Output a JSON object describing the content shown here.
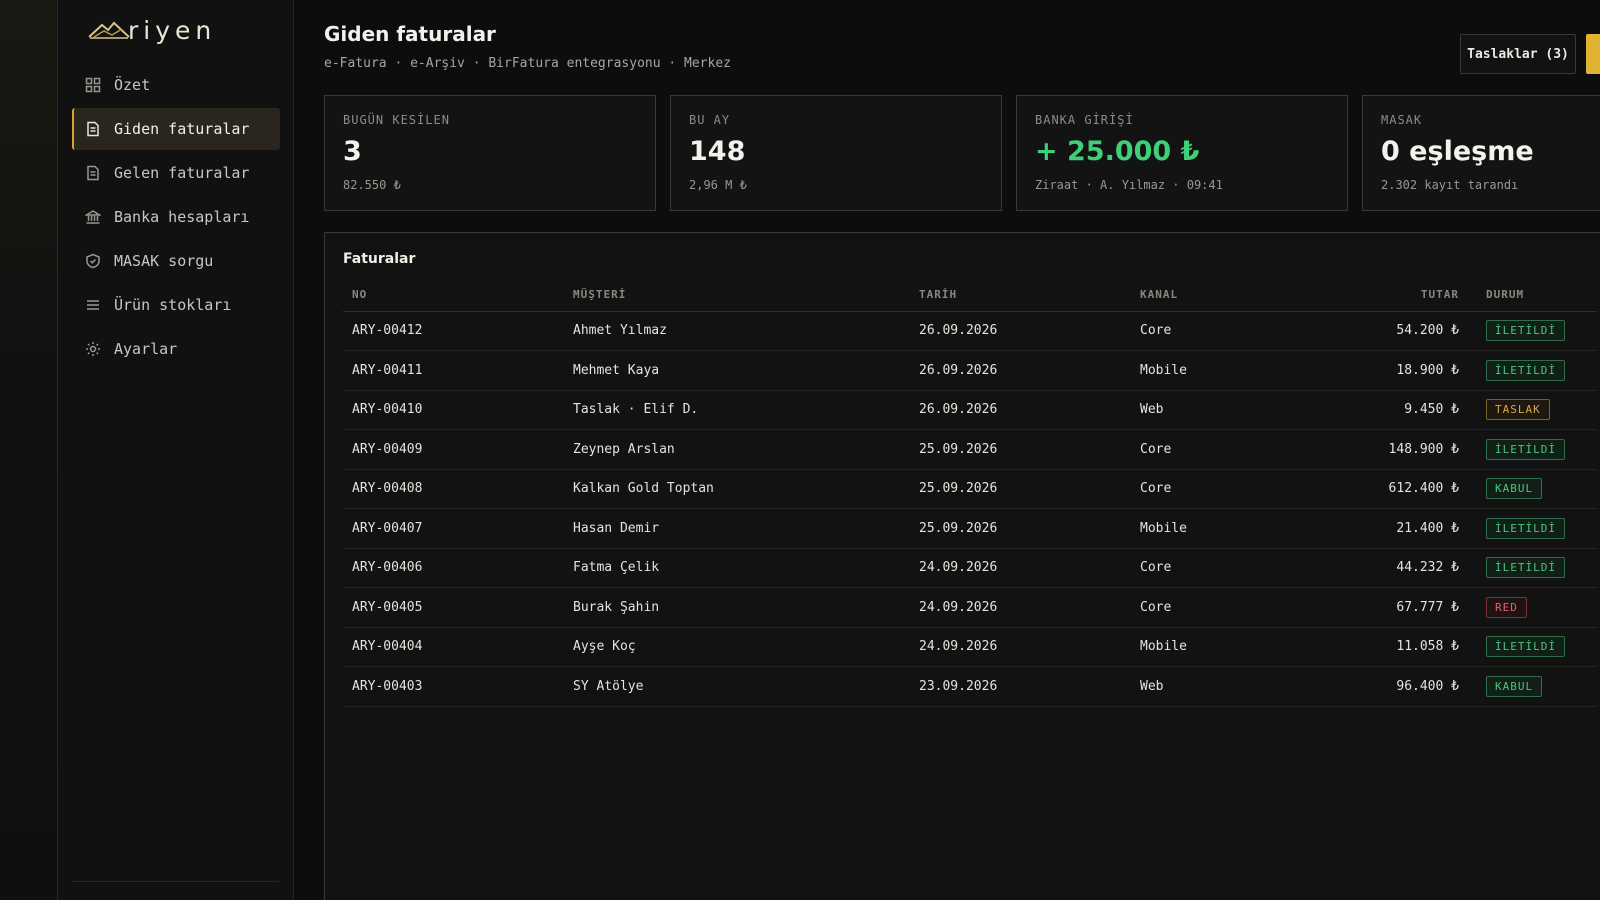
{
  "brand": {
    "name": "riyen"
  },
  "sidebar": {
    "items": [
      {
        "label": "Özet",
        "icon": "grid-icon",
        "active": false
      },
      {
        "label": "Giden faturalar",
        "icon": "document-icon",
        "active": true
      },
      {
        "label": "Gelen faturalar",
        "icon": "document-icon",
        "active": false
      },
      {
        "label": "Banka hesapları",
        "icon": "bank-icon",
        "active": false
      },
      {
        "label": "MASAK sorgu",
        "icon": "shield-icon",
        "active": false
      },
      {
        "label": "Ürün stokları",
        "icon": "list-icon",
        "active": false
      },
      {
        "label": "Ayarlar",
        "icon": "gear-icon",
        "active": false
      }
    ]
  },
  "header": {
    "title": "Giden faturalar",
    "subtitle": "e-Fatura · e-Arşiv · BirFatura entegrasyonu · Merkez",
    "drafts_button": "Taslaklar (3)"
  },
  "stats": [
    {
      "label": "BUGÜN KESİLEN",
      "value": "3",
      "sub": "82.550 ₺"
    },
    {
      "label": "BU AY",
      "value": "148",
      "sub": "2,96 M ₺"
    },
    {
      "label": "BANKA GİRİŞİ",
      "value": "+ 25.000 ₺",
      "sub": "Ziraat · A. Yılmaz · 09:41"
    },
    {
      "label": "MASAK",
      "value": "0 eşleşme",
      "sub": "2.302 kayıt tarandı"
    }
  ],
  "invoices": {
    "title": "Faturalar",
    "columns": [
      "NO",
      "MÜŞTERİ",
      "TARİH",
      "KANAL",
      "TUTAR",
      "DURUM"
    ],
    "rows": [
      {
        "no": "ARY-00412",
        "customer": "Ahmet Yılmaz",
        "date": "26.09.2026",
        "channel": "Core",
        "amount": "54.200 ₺",
        "status": "İLETİLDİ",
        "kind": "iletildi"
      },
      {
        "no": "ARY-00411",
        "customer": "Mehmet Kaya",
        "date": "26.09.2026",
        "channel": "Mobile",
        "amount": "18.900 ₺",
        "status": "İLETİLDİ",
        "kind": "iletildi"
      },
      {
        "no": "ARY-00410",
        "customer": "Taslak · Elif D.",
        "date": "26.09.2026",
        "channel": "Web",
        "amount": "9.450 ₺",
        "status": "TASLAK",
        "kind": "taslak"
      },
      {
        "no": "ARY-00409",
        "customer": "Zeynep Arslan",
        "date": "25.09.2026",
        "channel": "Core",
        "amount": "148.900 ₺",
        "status": "İLETİLDİ",
        "kind": "iletildi"
      },
      {
        "no": "ARY-00408",
        "customer": "Kalkan Gold Toptan",
        "date": "25.09.2026",
        "channel": "Core",
        "amount": "612.400 ₺",
        "status": "KABUL",
        "kind": "kabul"
      },
      {
        "no": "ARY-00407",
        "customer": "Hasan Demir",
        "date": "25.09.2026",
        "channel": "Mobile",
        "amount": "21.400 ₺",
        "status": "İLETİLDİ",
        "kind": "iletildi"
      },
      {
        "no": "ARY-00406",
        "customer": "Fatma Çelik",
        "date": "24.09.2026",
        "channel": "Core",
        "amount": "44.232 ₺",
        "status": "İLETİLDİ",
        "kind": "iletildi"
      },
      {
        "no": "ARY-00405",
        "customer": "Burak Şahin",
        "date": "24.09.2026",
        "channel": "Core",
        "amount": "67.777 ₺",
        "status": "RED",
        "kind": "red"
      },
      {
        "no": "ARY-00404",
        "customer": "Ayşe Koç",
        "date": "24.09.2026",
        "channel": "Mobile",
        "amount": "11.058 ₺",
        "status": "İLETİLDİ",
        "kind": "iletildi"
      },
      {
        "no": "ARY-00403",
        "customer": "SY Atölye",
        "date": "23.09.2026",
        "channel": "Web",
        "amount": "96.400 ₺",
        "status": "KABUL",
        "kind": "kabul"
      }
    ]
  },
  "colors": {
    "accent": "#d4a52a",
    "positive": "#3fcf78",
    "danger": "#e06565"
  }
}
